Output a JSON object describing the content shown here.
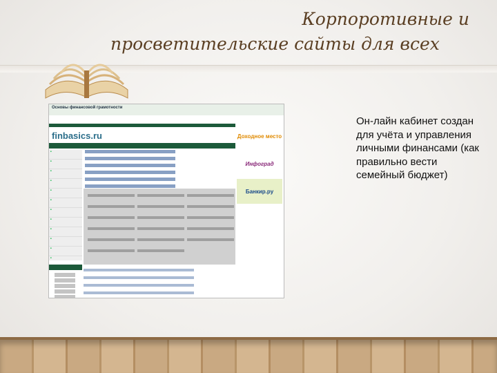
{
  "slide": {
    "title_line1": "Корпоротивные и",
    "title_line2": "просветительские сайты для всех",
    "caption": "Он-лайн кабинет создан для учёта и управления личными финансами (как правильно вести семейный бюджет)"
  },
  "website": {
    "header": "Основы финансовой грамотности",
    "logo": "finbasics.ru",
    "ads": [
      "Доходное место",
      "Инфоград",
      "Банкир.ру"
    ]
  },
  "colors": {
    "title": "#5a3e22",
    "site_bar": "#1c5a3a",
    "logo": "#2b6e8a"
  },
  "icons": {
    "decor": "open-book-icon"
  }
}
